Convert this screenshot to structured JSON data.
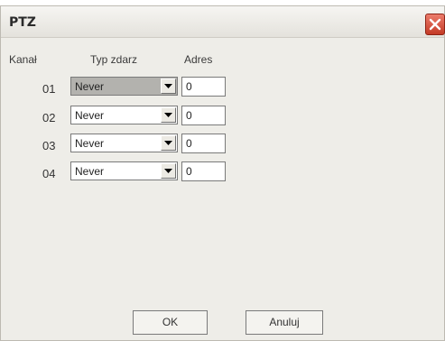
{
  "window": {
    "title": "PTZ"
  },
  "headers": {
    "channel": "Kanał",
    "event_type": "Typ zdarz",
    "address": "Adres"
  },
  "rows": [
    {
      "channel": "01",
      "event_type": "Never",
      "address": "0"
    },
    {
      "channel": "02",
      "event_type": "Never",
      "address": "0"
    },
    {
      "channel": "03",
      "event_type": "Never",
      "address": "0"
    },
    {
      "channel": "04",
      "event_type": "Never",
      "address": "0"
    }
  ],
  "buttons": {
    "ok": "OK",
    "cancel": "Anuluj"
  },
  "icons": {
    "close": "close-icon",
    "dropdown": "chevron-down-icon"
  },
  "colors": {
    "close_button": "#c43a26",
    "focused_select": "#b3b2ae",
    "dialog_background": "#eeede8"
  }
}
